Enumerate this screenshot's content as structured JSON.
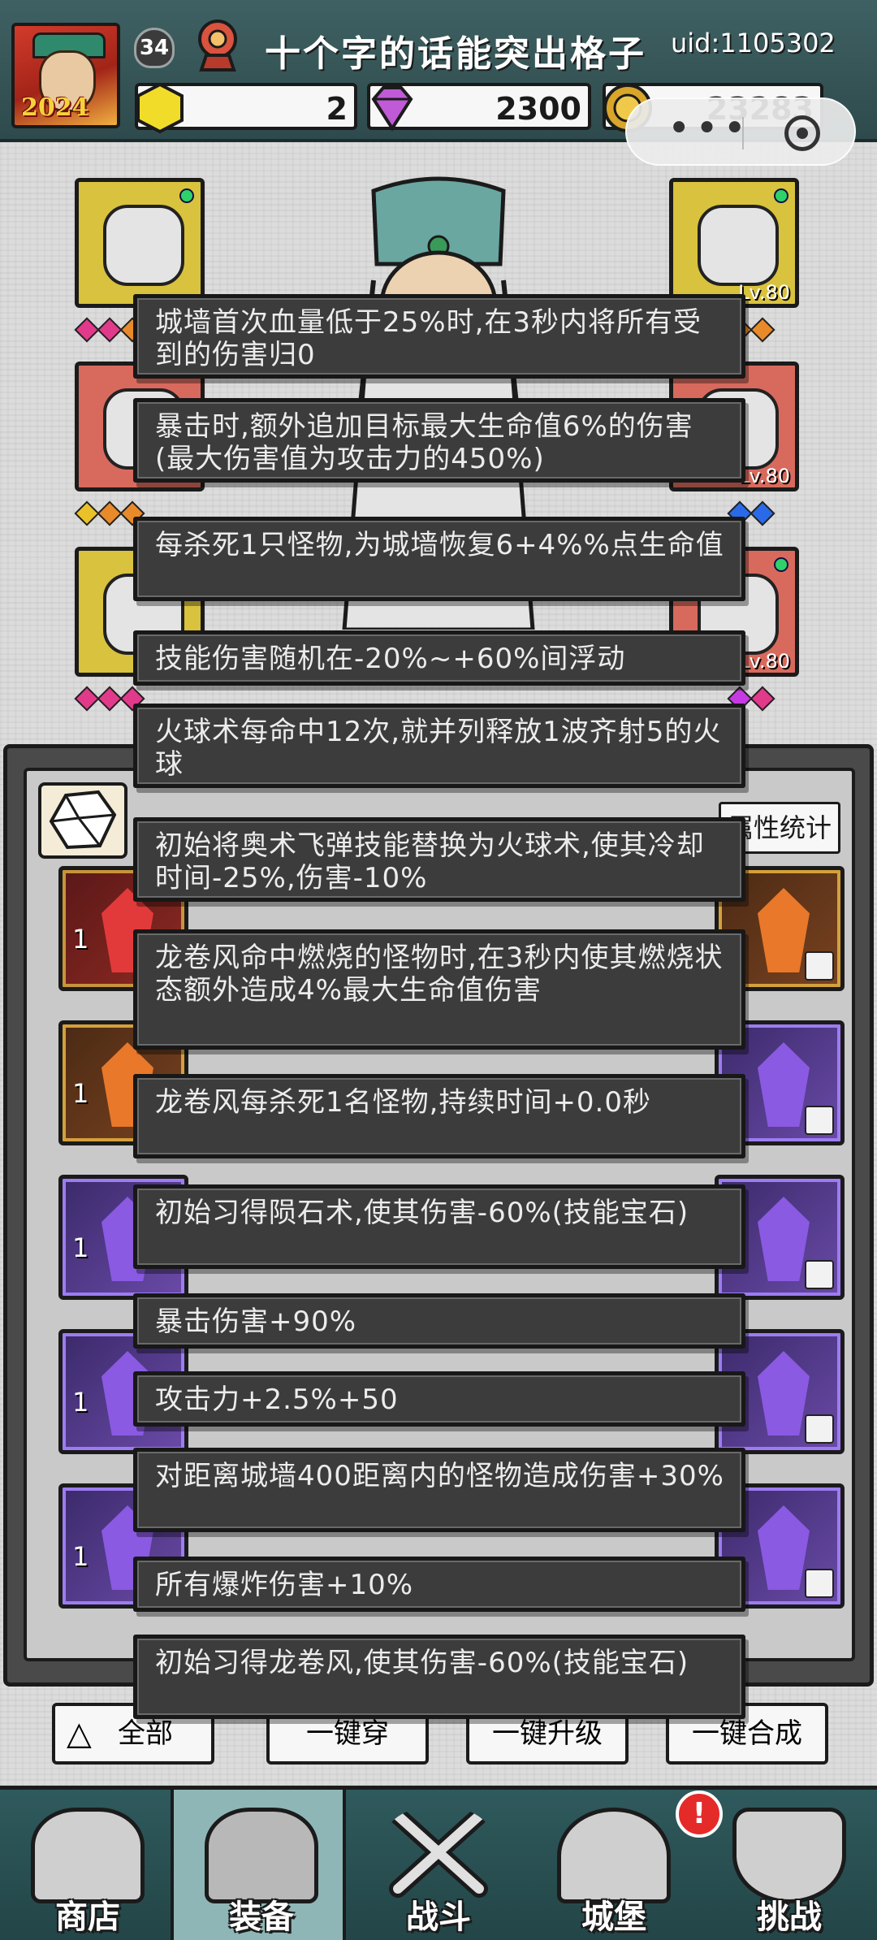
{
  "player": {
    "level": "34",
    "name": "十个字的话能突出格子",
    "uid": "uid:1105302",
    "avatar_year": "2024"
  },
  "currencies": [
    {
      "icon": "gold-gem-icon",
      "value": "2"
    },
    {
      "icon": "diamond-icon",
      "value": "2300"
    },
    {
      "icon": "coin-icon",
      "value": "23283"
    }
  ],
  "equipment_levels": {
    "right_top": "Lv.80",
    "right_mid": "Lv.80",
    "right_bottom": "Lv.80"
  },
  "bag": {
    "stat_tab": "属性统计",
    "rows": [
      {
        "left": "1",
        "left_color": "red",
        "right_color": "orange"
      },
      {
        "left": "1",
        "left_color": "orange",
        "right_color": "purple"
      },
      {
        "left": "1",
        "left_color": "purple",
        "right_color": "purple"
      },
      {
        "left": "1",
        "left_color": "purple",
        "right_color": "purple"
      },
      {
        "left": "1",
        "left_color": "purple",
        "right_color": "purple"
      }
    ],
    "bottom_buttons": [
      "全部",
      "一键穿",
      "一键升级",
      "一键合成"
    ]
  },
  "tooltips": [
    "城墙首次血量低于25%时,在3秒内将所有受到的伤害归0",
    "暴击时,额外追加目标最大生命值6%的伤害(最大伤害值为攻击力的450%)",
    "每杀死1只怪物,为城墙恢复6+4%%点生命值",
    "技能伤害随机在-20%~+60%间浮动",
    "火球术每命中12次,就并列释放1波齐射5的火球",
    "初始将奥术飞弹技能替换为火球术,使其冷却时间-25%,伤害-10%",
    "龙卷风命中燃烧的怪物时,在3秒内使其燃烧状态额外造成4%最大生命值伤害",
    "龙卷风每杀死1名怪物,持续时间+0.0秒",
    "初始习得陨石术,使其伤害-60%(技能宝石)",
    "暴击伤害+90%",
    "攻击力+2.5%+50",
    "对距离城墙400距离内的怪物造成伤害+30%",
    "所有爆炸伤害+10%",
    "初始习得龙卷风,使其伤害-60%(技能宝石)"
  ],
  "nav": [
    {
      "label": "商店",
      "icon": "shop-icon"
    },
    {
      "label": "装备",
      "icon": "backpack-icon",
      "active": true
    },
    {
      "label": "战斗",
      "icon": "crossed-swords-icon"
    },
    {
      "label": "城堡",
      "icon": "castle-icon"
    },
    {
      "label": "挑战",
      "icon": "shield-icon"
    }
  ],
  "alert_badge": "!"
}
